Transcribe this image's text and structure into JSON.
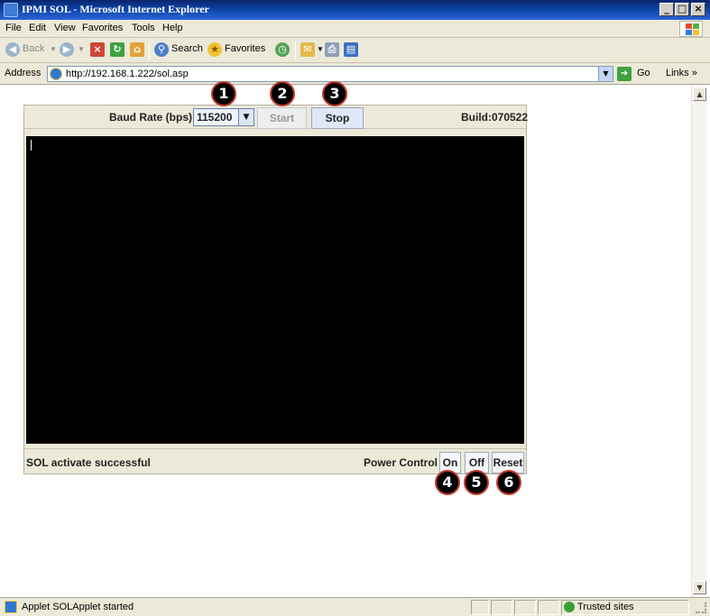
{
  "window": {
    "title": "IPMI SOL - Microsoft Internet Explorer",
    "controls": {
      "minimize": "_",
      "maximize": "□",
      "close": "×"
    }
  },
  "menu": {
    "items": [
      {
        "label": "File"
      },
      {
        "label": "Edit"
      },
      {
        "label": "View"
      },
      {
        "label": "Favorites"
      },
      {
        "label": "Tools"
      },
      {
        "label": "Help"
      }
    ]
  },
  "toolbar": {
    "back_label": "Back",
    "search_label": "Search",
    "favorites_label": "Favorites"
  },
  "address": {
    "label": "Address",
    "url": "http://192.168.1.222/sol.asp",
    "go_label": "Go",
    "links_label": "Links »"
  },
  "applet": {
    "baud_label": "Baud Rate (bps)",
    "baud_value": "115200",
    "start_label": "Start",
    "stop_label": "Stop",
    "build_label": "Build:070522",
    "sol_status": "SOL activate successful",
    "power_label": "Power Control :",
    "on_label": "On",
    "off_label": "Off",
    "reset_label": "Reset"
  },
  "callouts": [
    "1",
    "2",
    "3",
    "4",
    "5",
    "6"
  ],
  "statusbar": {
    "text": "Applet SOLApplet started",
    "zone": "Trusted sites"
  },
  "colors": {
    "titlebar": "#0b3fa0",
    "chrome": "#ece9d8",
    "terminal": "#000000",
    "callout_border": "#c0392b"
  }
}
